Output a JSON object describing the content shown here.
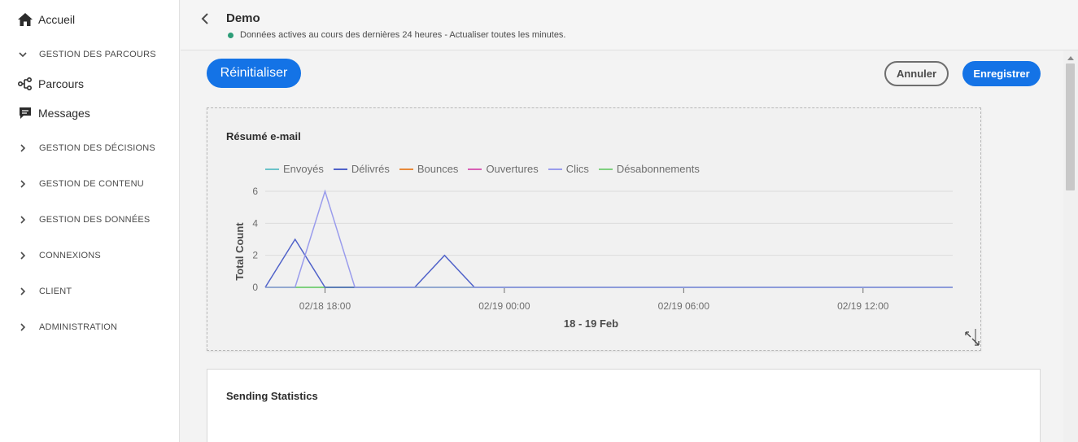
{
  "sidebar": {
    "home": "Accueil",
    "groups": {
      "journeys": "GESTION DES PARCOURS",
      "decisions": "GESTION DES DÉCISIONS",
      "content": "GESTION DE CONTENU",
      "data": "GESTION DES DONNÉES",
      "connections": "CONNEXIONS",
      "client": "CLIENT",
      "admin": "ADMINISTRATION"
    },
    "items": {
      "journeys": "Parcours",
      "messages": "Messages"
    }
  },
  "header": {
    "title": "Demo",
    "status": "Données actives au cours des dernières 24 heures - Actualiser toutes les minutes."
  },
  "actions": {
    "reset": "Réinitialiser",
    "cancel": "Annuler",
    "save": "Enregistrer"
  },
  "cards": {
    "email_summary": "Résumé e-mail",
    "sending_stats": "Sending Statistics"
  },
  "colors": {
    "accent": "#1473e6",
    "status_dot": "#2d9d78"
  },
  "chart_data": {
    "type": "line",
    "title": "Résumé e-mail",
    "xlabel": "18 - 19 Feb",
    "ylabel": "Total Count",
    "ylim": [
      0,
      6
    ],
    "yticks": [
      0,
      2,
      4,
      6
    ],
    "xticks": [
      "02/18 18:00",
      "02/19 00:00",
      "02/19 06:00",
      "02/19 12:00"
    ],
    "x": [
      "02/18 16:00",
      "02/18 17:00",
      "02/18 18:00",
      "02/18 19:00",
      "02/18 20:00",
      "02/18 21:00",
      "02/18 22:00",
      "02/18 23:00",
      "02/19 00:00",
      "02/19 01:00",
      "02/19 02:00",
      "02/19 03:00",
      "02/19 04:00",
      "02/19 05:00",
      "02/19 06:00",
      "02/19 07:00",
      "02/19 08:00",
      "02/19 09:00",
      "02/19 10:00",
      "02/19 11:00",
      "02/19 12:00",
      "02/19 13:00",
      "02/19 14:00",
      "02/19 15:00"
    ],
    "legend_position": "top",
    "series": [
      {
        "name": "Envoyés",
        "color": "#6cc3c9",
        "values": [
          0,
          0,
          0,
          0,
          0,
          0,
          0,
          0,
          0,
          0,
          0,
          0,
          0,
          0,
          0,
          0,
          0,
          0,
          0,
          0,
          0,
          0,
          0,
          0
        ]
      },
      {
        "name": "Délivrés",
        "color": "#5062c9",
        "values": [
          0,
          3,
          0,
          0,
          0,
          0,
          2,
          0,
          0,
          0,
          0,
          0,
          0,
          0,
          0,
          0,
          0,
          0,
          0,
          0,
          0,
          0,
          0,
          0
        ]
      },
      {
        "name": "Bounces",
        "color": "#e8893a",
        "values": [
          0,
          0,
          0,
          0,
          0,
          0,
          0,
          0,
          0,
          0,
          0,
          0,
          0,
          0,
          0,
          0,
          0,
          0,
          0,
          0,
          0,
          0,
          0,
          0
        ]
      },
      {
        "name": "Ouvertures",
        "color": "#d85fb5",
        "values": [
          0,
          0,
          0,
          0,
          0,
          0,
          0,
          0,
          0,
          0,
          0,
          0,
          0,
          0,
          0,
          0,
          0,
          0,
          0,
          0,
          0,
          0,
          0,
          0
        ]
      },
      {
        "name": "Clics",
        "color": "#9a9cec",
        "values": [
          0,
          0,
          6,
          0,
          0,
          0,
          0,
          0,
          0,
          0,
          0,
          0,
          0,
          0,
          0,
          0,
          0,
          0,
          0,
          0,
          0,
          0,
          0,
          0
        ]
      },
      {
        "name": "Désabonnements",
        "color": "#7fd07f",
        "values": [
          0,
          0,
          0,
          0,
          0,
          0,
          0,
          0,
          0,
          0,
          0,
          0,
          0,
          0,
          0,
          0,
          0,
          0,
          0,
          0,
          0,
          0,
          0,
          0
        ]
      }
    ]
  }
}
